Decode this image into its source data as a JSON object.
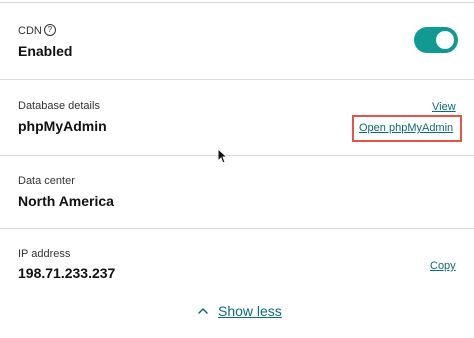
{
  "cdn": {
    "label": "CDN",
    "help_glyph": "?",
    "value": "Enabled",
    "toggle_on": true,
    "toggle_color": "#119a92"
  },
  "database": {
    "label": "Database details",
    "value": "phpMyAdmin",
    "view_link": "View",
    "open_link": "Open phpMyAdmin",
    "highlight_color": "#e5544b"
  },
  "datacenter": {
    "label": "Data center",
    "value": "North America"
  },
  "ip": {
    "label": "IP address",
    "value": "198.71.233.237",
    "copy_link": "Copy"
  },
  "footer": {
    "show_less": "Show less",
    "chevron_icon": "chevron-up-icon"
  },
  "link_color": "#0a6d74"
}
